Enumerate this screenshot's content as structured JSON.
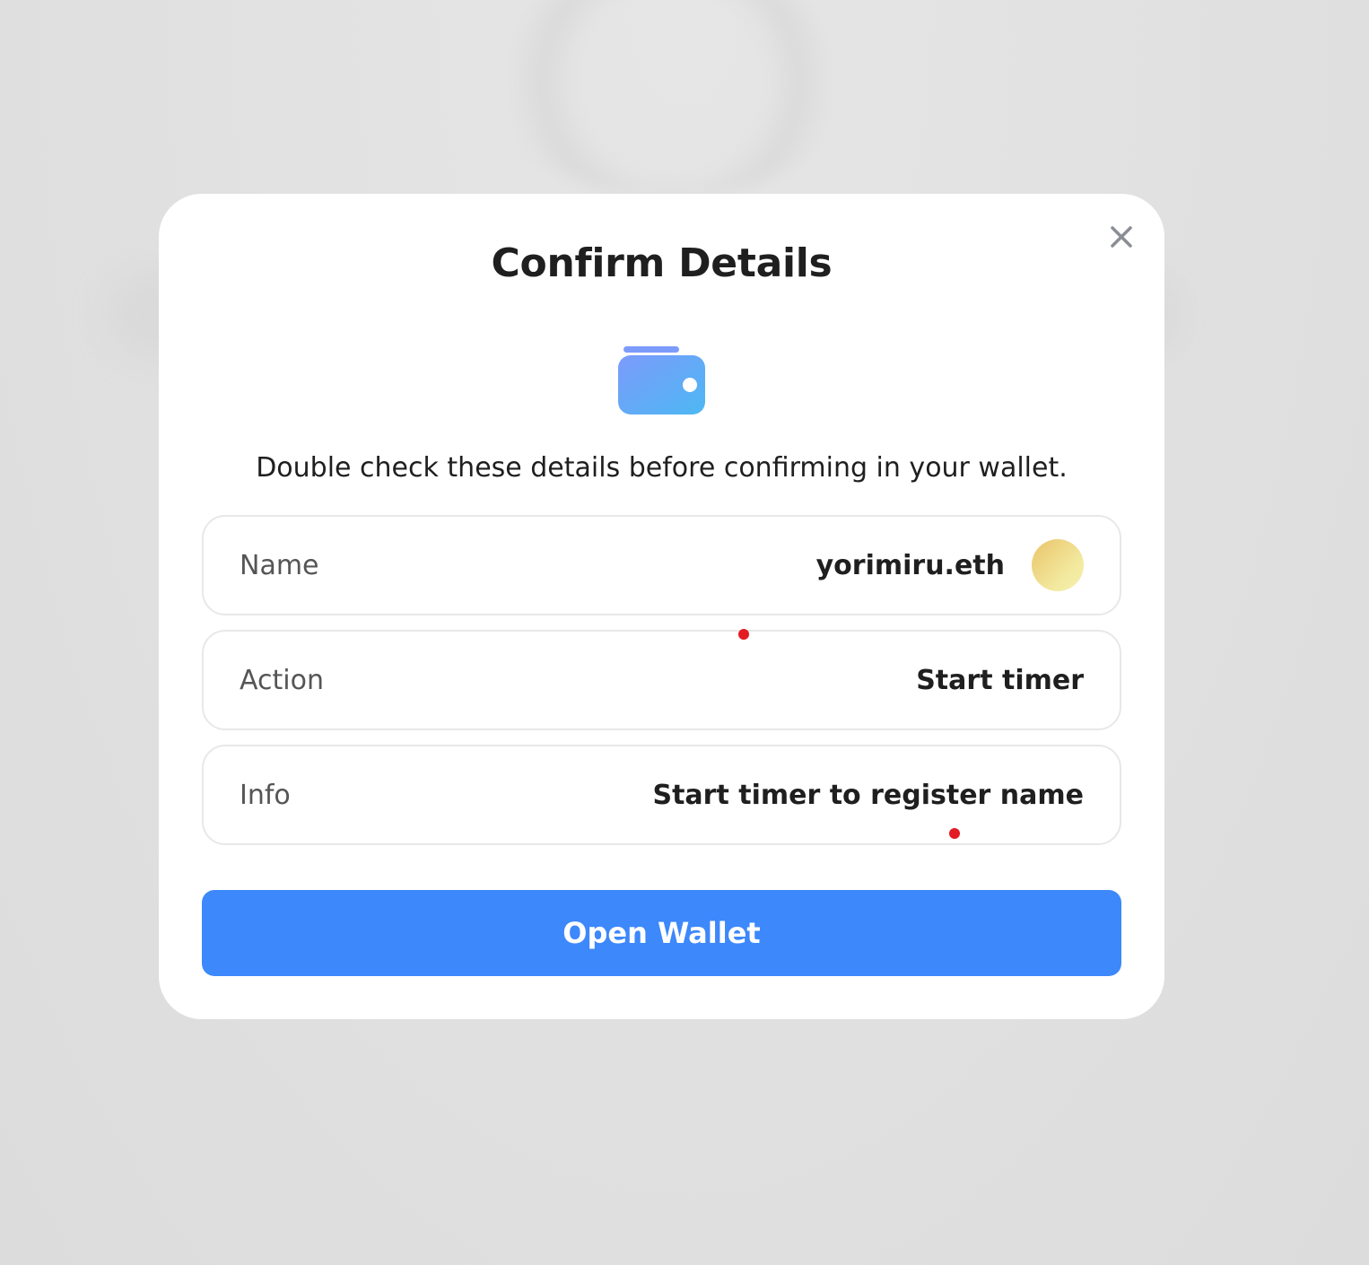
{
  "modal": {
    "title": "Confirm Details",
    "subtitle": "Double check these details before confirming in your wallet.",
    "rows": [
      {
        "label": "Name",
        "value": "yorimiru.eth"
      },
      {
        "label": "Action",
        "value": "Start timer"
      },
      {
        "label": "Info",
        "value": "Start timer to register name"
      }
    ],
    "primary_button": "Open Wallet"
  },
  "icons": {
    "close": "close-icon",
    "wallet": "wallet-icon",
    "avatar": "avatar"
  },
  "colors": {
    "primary": "#3d88fb",
    "wallet_gradient_start": "#7c9bfb",
    "wallet_gradient_end": "#4db8f3",
    "avatar_gradient_start": "#e9c46a",
    "avatar_gradient_end": "#f6f0b0",
    "marker": "#e31b23"
  }
}
